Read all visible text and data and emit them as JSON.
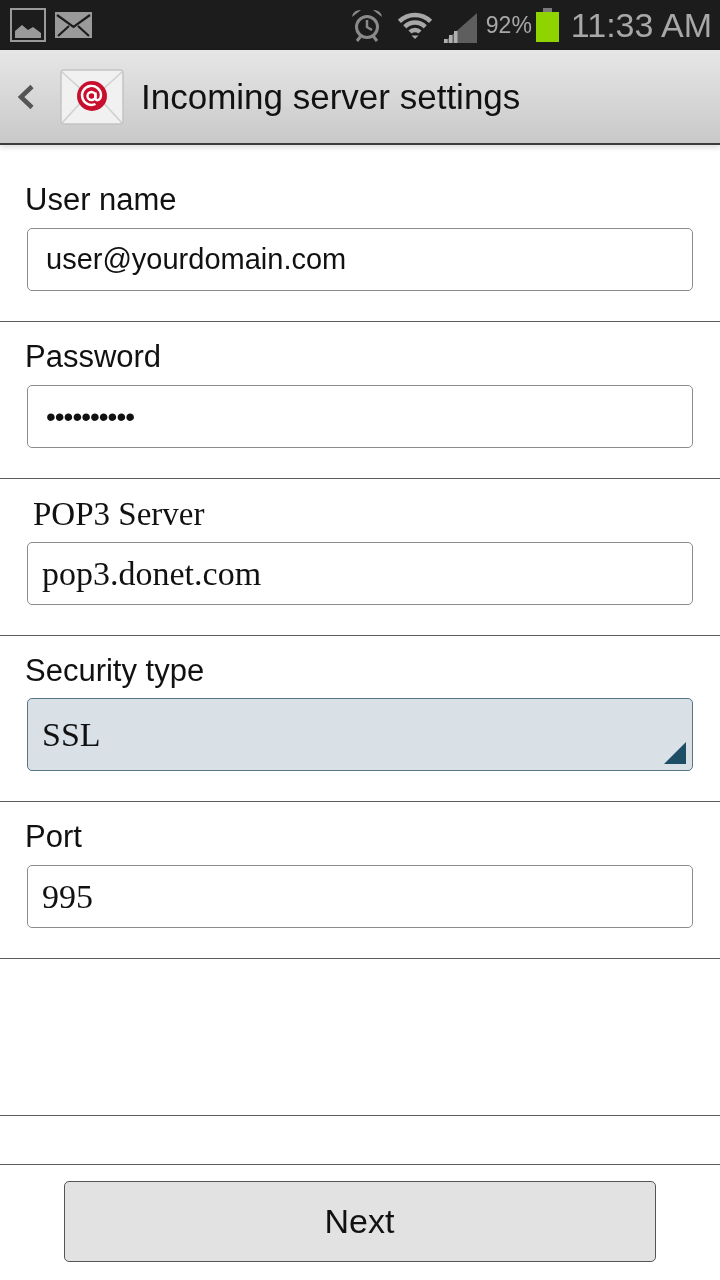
{
  "status_bar": {
    "battery_percent": "92%",
    "time": "11:33 AM"
  },
  "header": {
    "title": "Incoming server settings"
  },
  "fields": [
    {
      "kind": "text",
      "label": "User name",
      "value": "user@yourdomain.com"
    },
    {
      "kind": "password",
      "label": "Password",
      "value": "••••••••••"
    },
    {
      "kind": "text",
      "label": "POP3 Server",
      "value": "pop3.donet.com"
    },
    {
      "kind": "dropdown",
      "label": "Security type",
      "value": "SSL"
    },
    {
      "kind": "text",
      "label": "Port",
      "value": "995"
    }
  ],
  "buttons": [
    {
      "label": "Next"
    }
  ]
}
